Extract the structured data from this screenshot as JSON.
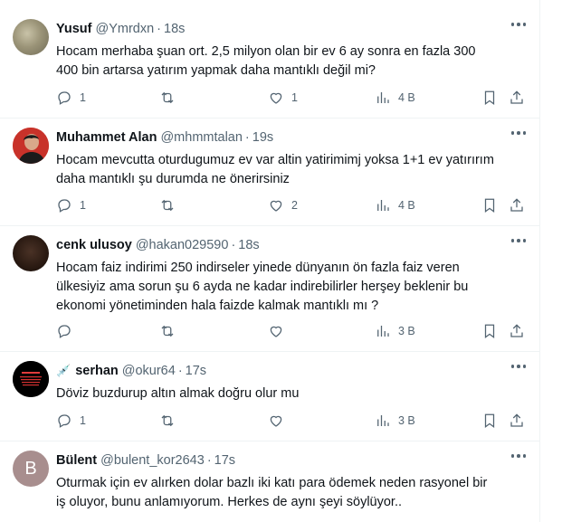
{
  "tweets": [
    {
      "name": "Yusuf",
      "handle": "@Ymrdxn",
      "sep": "·",
      "time": "18s",
      "lines": [
        "Hocam merhaba şuan ort. 2,5 milyon olan bir ev 6 ay sonra en fazla 300",
        "400 bin artarsa yatırım yapmak daha mantıklı değil mi?"
      ],
      "replies": "1",
      "retweets": "",
      "likes": "1",
      "views": "4 B"
    },
    {
      "name": "Muhammet Alan",
      "handle": "@mhmmtalan",
      "sep": "·",
      "time": "19s",
      "lines": [
        "Hocam mevcutta oturdugumuz ev var altin yatirimimj yoksa 1+1 ev yatırırım",
        "daha mantıklı şu durumda ne önerirsiniz"
      ],
      "replies": "1",
      "retweets": "",
      "likes": "2",
      "views": "4 B"
    },
    {
      "name": "cenk ulusoy",
      "handle": "@hakan029590",
      "sep": "·",
      "time": "18s",
      "lines": [
        "Hocam faiz indirimi 250 indirseler yinede dünyanın ön fazla faiz veren",
        "ülkesiyiz ama sorun şu 6 ayda ne kadar indirebilirler herşey beklenir bu",
        "ekonomi yönetiminden hala faizde kalmak mantıklı mı ?"
      ],
      "replies": "",
      "retweets": "",
      "likes": "",
      "views": "3 B"
    },
    {
      "name": "serhan",
      "name_emoji": "💉",
      "handle": "@okur64",
      "sep": "·",
      "time": "17s",
      "lines": [
        "Döviz buzdurup altın almak doğru olur mu"
      ],
      "replies": "1",
      "retweets": "",
      "likes": "",
      "views": "3 B"
    },
    {
      "name": "Bülent",
      "handle": "@bulent_kor2643",
      "sep": "·",
      "time": "17s",
      "avatar_letter": "B",
      "lines": [
        "Oturmak için ev alırken dolar bazlı iki katı para ödemek neden rasyonel bir",
        "iş oluyor, bunu anlamıyorum. Herkes de aynı şeyi söylüyor.."
      ]
    }
  ],
  "colors": {
    "text": "#0f1419",
    "secondary": "#536471",
    "border": "#eff3f4"
  },
  "icons": [
    "reply-icon",
    "retweet-icon",
    "like-icon",
    "views-icon",
    "bookmark-icon",
    "share-icon",
    "more-icon"
  ]
}
